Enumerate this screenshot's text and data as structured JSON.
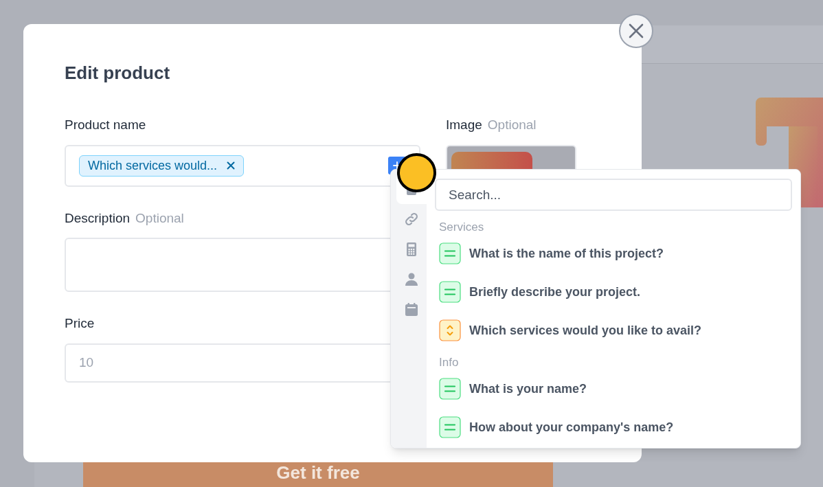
{
  "background": {
    "button": "Get it free"
  },
  "modal": {
    "title": "Edit product",
    "fields": [
      {
        "kind": "tags",
        "label": "Product name",
        "tags": [
          "Which services would..."
        ]
      },
      {
        "kind": "textarea",
        "label": "Description",
        "optional": "Optional"
      },
      {
        "kind": "input",
        "label": "Price",
        "placeholder": "10"
      }
    ],
    "image": {
      "label": "Image",
      "optional": "Optional"
    }
  },
  "popover": {
    "search": {
      "placeholder": "Search..."
    },
    "tabs": [
      {
        "selected": true
      },
      {
        "selected": false
      },
      {
        "selected": false
      },
      {
        "selected": false
      },
      {
        "selected": false
      }
    ],
    "groups": [
      {
        "title": "Services",
        "items": [
          {
            "kind": "text",
            "label": "What is the name of this project?"
          },
          {
            "kind": "text",
            "label": "Briefly describe your project."
          },
          {
            "kind": "select",
            "label": "Which services would you like to avail?"
          }
        ]
      },
      {
        "title": "Info",
        "items": [
          {
            "kind": "text",
            "label": "What is your name?"
          },
          {
            "kind": "text",
            "label": "How about your company's name?"
          }
        ]
      }
    ]
  }
}
